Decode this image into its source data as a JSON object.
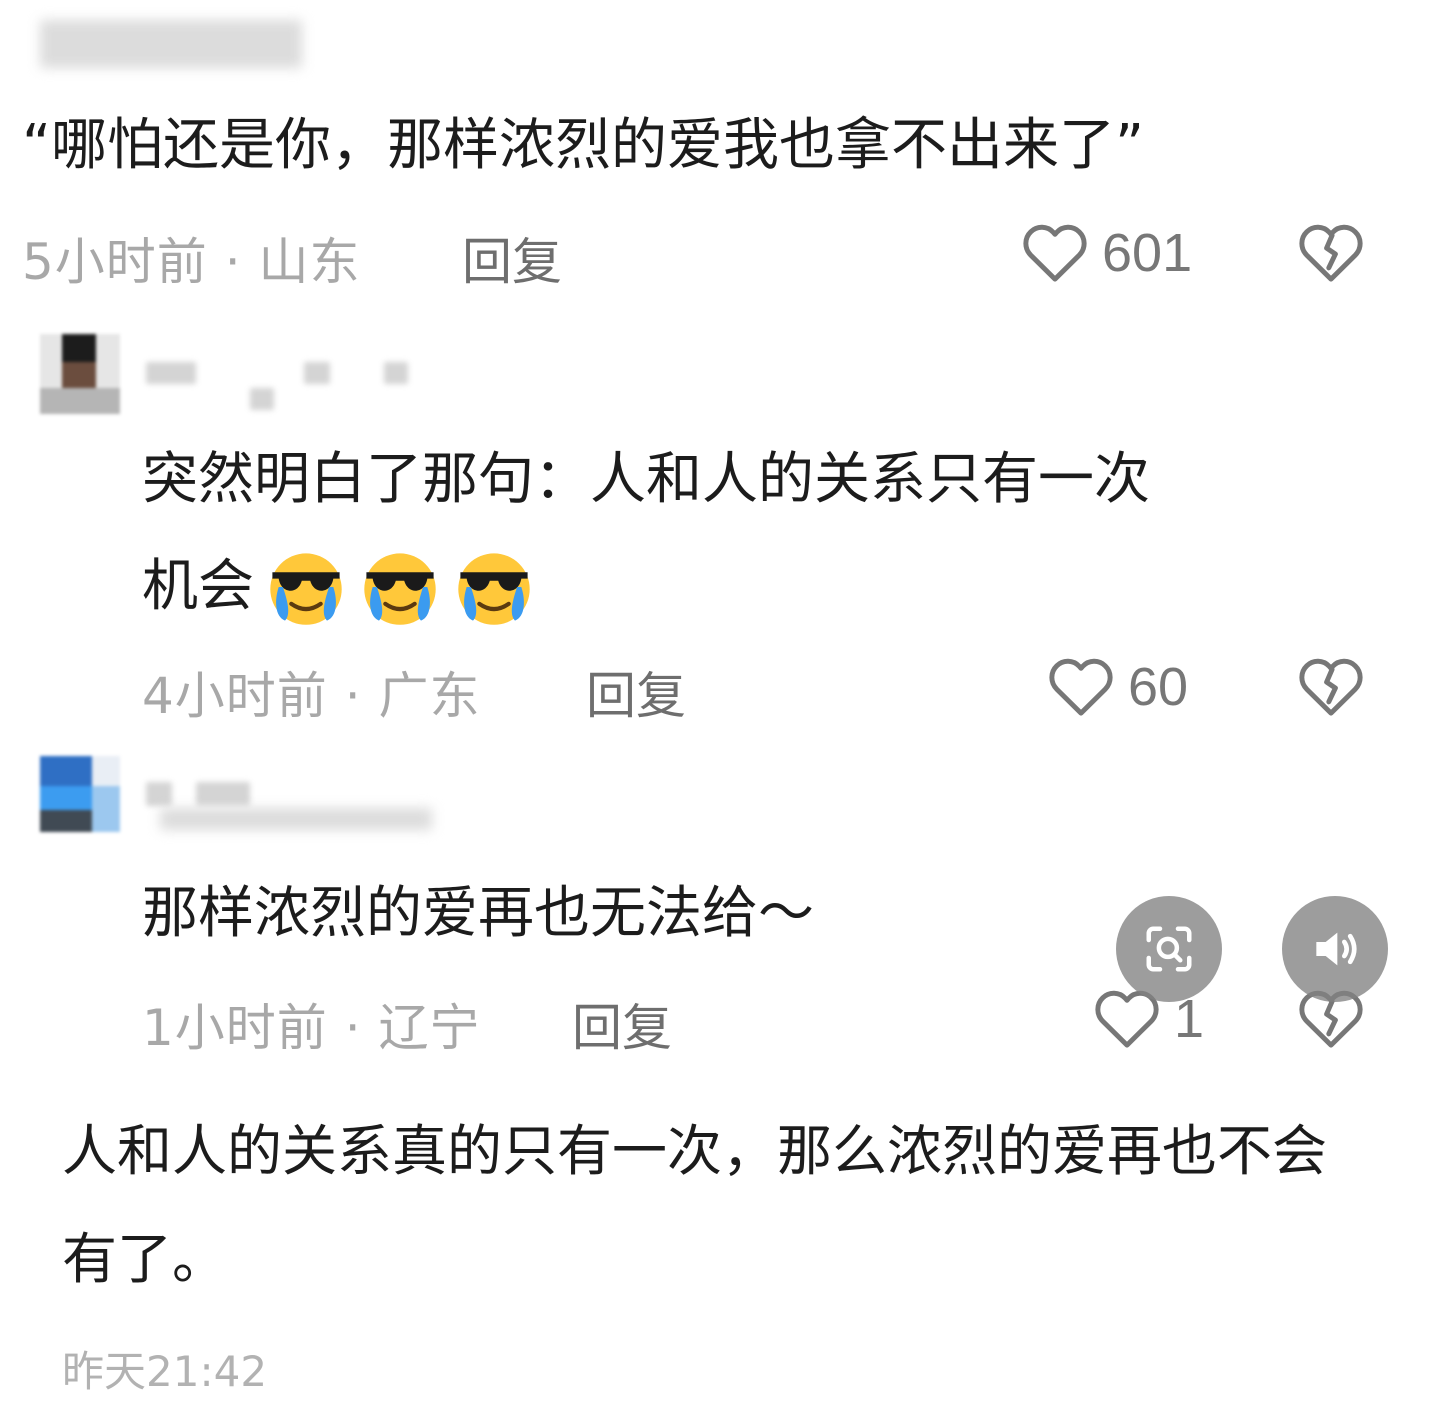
{
  "comments": [
    {
      "text": "“哪怕还是你，那样浓烈的爱我也拿不出来了”",
      "time_location": "5小时前 · 山东",
      "reply_label": "回复",
      "likes": "601"
    },
    {
      "text_line1": "突然明白了那句：人和人的关系只有一次",
      "text_line2": "机会",
      "emoji_name": "sunglasses-crying-emoji",
      "emoji_count": 3,
      "time_location": "4小时前 · 广东",
      "reply_label": "回复",
      "likes": "60"
    },
    {
      "text": "那样浓烈的爱再也无法给～",
      "time_location": "1小时前 · 辽宁",
      "reply_label": "回复",
      "likes": "1"
    }
  ],
  "caption": {
    "line1": "人和人的关系真的只有一次，那么浓烈的爱再也不会",
    "line2": "有了。",
    "timestamp": "昨天21:42"
  },
  "icons": {
    "like": "heart-outline-icon",
    "dislike": "broken-heart-icon",
    "lens": "image-search-icon",
    "sound": "speaker-icon"
  },
  "colors": {
    "text": "#1c1c1c",
    "meta": "#a8a8a8",
    "reply": "#6e6e6e",
    "icon": "#777777",
    "fab": "#828282"
  }
}
